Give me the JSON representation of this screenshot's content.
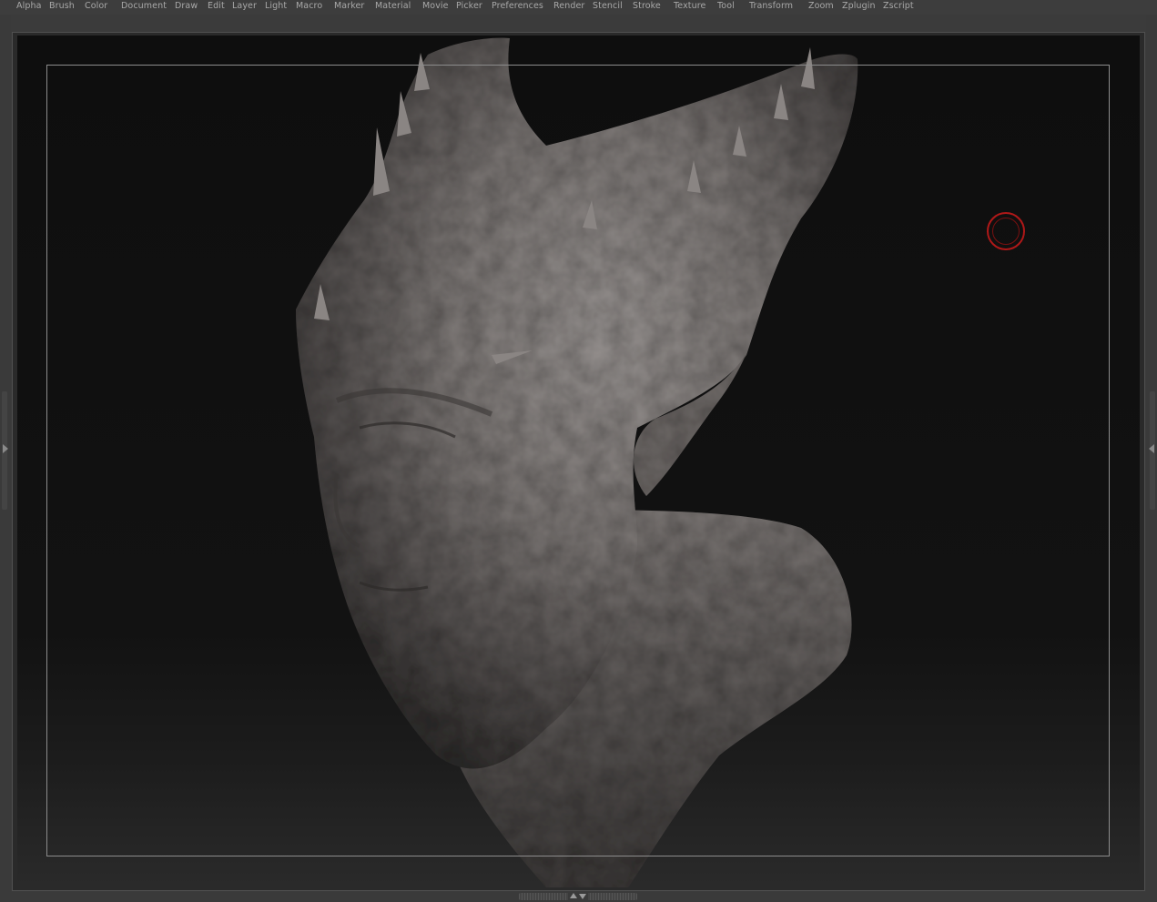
{
  "menu": {
    "items": [
      "Alpha",
      "Brush",
      "Color",
      "Document",
      "Draw",
      "Edit",
      "Layer",
      "Light",
      "Macro",
      "Marker",
      "Material",
      "Movie",
      "Picker",
      "Preferences",
      "Render",
      "Stencil",
      "Stroke",
      "Texture",
      "Tool",
      "Transform",
      "Zoom",
      "Zplugin",
      "Zscript"
    ]
  },
  "canvas": {
    "subject": "sculpted-creature-bust",
    "brush_cursor_color": "#b01818",
    "background_color": "#101010",
    "frame_color": "#8c8c8c"
  },
  "colors": {
    "menu_text": "#a8a8a8",
    "chrome": "#3b3b3b",
    "clay": "#7a7573"
  }
}
